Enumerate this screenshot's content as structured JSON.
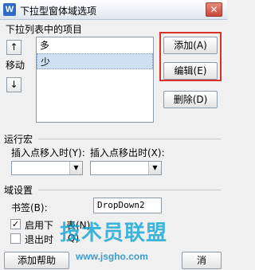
{
  "window": {
    "icon_letter": "W",
    "title": "下拉型窗体域选项",
    "close_glyph": "✕"
  },
  "dropdown_items": {
    "section_label": "下拉列表中的项目",
    "items": [
      {
        "label": "多"
      },
      {
        "label": "少",
        "selected": true
      }
    ],
    "move_label": "移动",
    "move_up_glyph": "↑",
    "move_down_glyph": "↓"
  },
  "buttons": {
    "add": "添加(A)",
    "edit": "编辑(E)",
    "delete": "删除(D)"
  },
  "macro": {
    "section_label": "运行宏",
    "entry_label": "插入点移入时(Y):",
    "exit_label": "插入点移出时(X):"
  },
  "field_settings": {
    "section_label": "域设置",
    "bookmark_label": "书签(B):",
    "bookmark_value": "DropDown2",
    "enable_label": "启用下",
    "enable_label_tail": "表(N)",
    "enable_checked": true,
    "exit_calc_label": "退出时",
    "exit_calc_tail": "Q)",
    "exit_calc_checked": false
  },
  "footer": {
    "help_button": "添加帮助",
    "cancel_button": "消"
  },
  "watermark": {
    "brand": "技术员联盟",
    "url": "www.jsgho.com"
  },
  "colors": {
    "highlight": "#d9302a",
    "selection": "#cfe0f5",
    "watermark": "#00a0d2"
  }
}
